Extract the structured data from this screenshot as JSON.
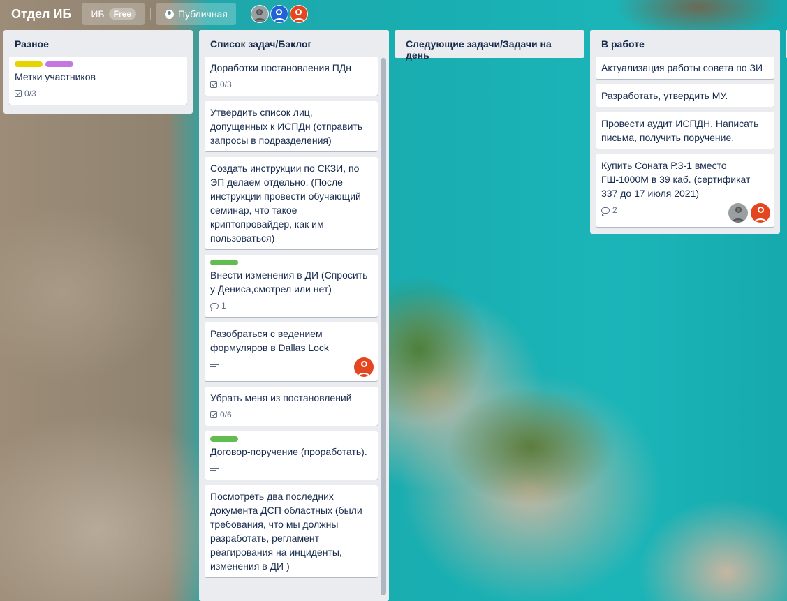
{
  "header": {
    "board_title": "Отдел ИБ",
    "workspace_label": "ИБ",
    "plan_badge": "Free",
    "visibility_label": "Публичная"
  },
  "lists": [
    {
      "title": "Разное",
      "cards": [
        {
          "labels": [
            "#e7d300",
            "#c377e0"
          ],
          "title": "Метки участников",
          "checklist": "0/3"
        }
      ]
    },
    {
      "title": "Список задач/Бэклог",
      "cards": [
        {
          "title": "Доработки постановления ПДн",
          "checklist": "0/3"
        },
        {
          "title": "Утвердить список лиц, допущенных к ИСПДн (отправить запросы в подразделения)"
        },
        {
          "title": "Создать инструкции по СКЗИ, по ЭП делаем отдельно. (После инструкции провести обучающий семинар, что такое криптопровайдер, как им пользоваться)"
        },
        {
          "labels": [
            "#61bd4f"
          ],
          "title": "Внести изменения в ДИ (Спросить у Дениса,смотрел или нет)",
          "comments": "1"
        },
        {
          "title": "Разобраться с ведением формуляров в Dallas Lock",
          "has_description": true
        },
        {
          "title": "Убрать меня из постановлений",
          "checklist": "0/6"
        },
        {
          "labels": [
            "#61bd4f"
          ],
          "title": "Договор-поручение (проработать).",
          "has_description": true
        },
        {
          "title": "Посмотреть два последних документа ДСП областных (были требования, что мы должны разработать, регламент реагирования на инциденты, изменения в ДИ )"
        }
      ]
    },
    {
      "title": "Следующие задачи/Задачи на день",
      "cards": []
    },
    {
      "title": "В работе",
      "cards": [
        {
          "title": "Актуализация работы совета по ЗИ"
        },
        {
          "title": "Разработать, утвердить МУ."
        },
        {
          "title": "Провести аудит ИСПДН. Написать письма, получить поручение."
        },
        {
          "title": "Купить Соната Р.3-1 вместо ГШ-1000М в 39 каб. (сертификат 337 до 17 июля 2021)",
          "comments": "2"
        }
      ]
    }
  ]
}
